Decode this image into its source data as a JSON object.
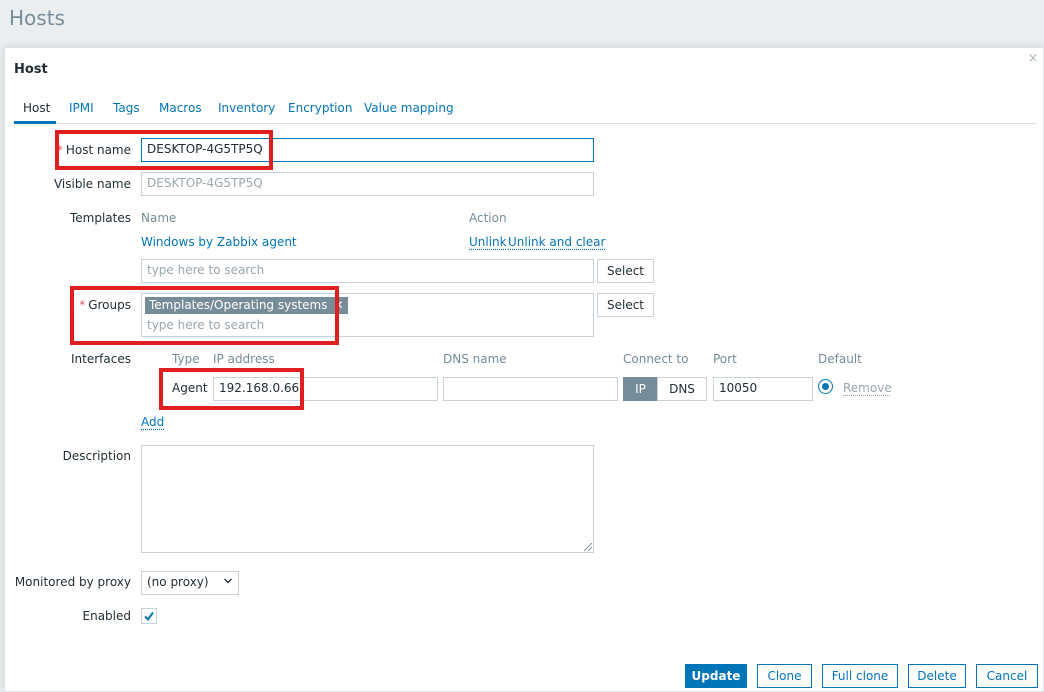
{
  "page": {
    "title": "Hosts"
  },
  "dialog": {
    "title": "Host",
    "close_glyph": "×"
  },
  "tabs": [
    {
      "label": "Host",
      "active": true
    },
    {
      "label": "IPMI"
    },
    {
      "label": "Tags"
    },
    {
      "label": "Macros"
    },
    {
      "label": "Inventory"
    },
    {
      "label": "Encryption"
    },
    {
      "label": "Value mapping"
    }
  ],
  "form": {
    "required_mark": "*",
    "host_name": {
      "label": "Host name",
      "value": "DESKTOP-4G5TP5Q"
    },
    "visible_name": {
      "label": "Visible name",
      "placeholder": "DESKTOP-4G5TP5Q"
    },
    "templates": {
      "label": "Templates",
      "col_name": "Name",
      "col_action": "Action",
      "rows": [
        {
          "name": "Windows by Zabbix agent",
          "unlink": "Unlink",
          "unlink_clear": "Unlink and clear"
        }
      ],
      "search_placeholder": "type here to search",
      "select_label": "Select"
    },
    "groups": {
      "label": "Groups",
      "chips": [
        "Templates/Operating systems"
      ],
      "search_placeholder": "type here to search",
      "select_label": "Select"
    },
    "interfaces": {
      "label": "Interfaces",
      "headers": {
        "type": "Type",
        "ip": "IP address",
        "dns": "DNS name",
        "connect": "Connect to",
        "port": "Port",
        "default": "Default"
      },
      "rows": [
        {
          "type": "Agent",
          "ip": "192.168.0.66",
          "dns": "",
          "connect_ip": "IP",
          "connect_dns": "DNS",
          "connect_selected": "IP",
          "port": "10050",
          "remove": "Remove"
        }
      ],
      "add_label": "Add"
    },
    "description": {
      "label": "Description",
      "value": ""
    },
    "proxy": {
      "label": "Monitored by proxy",
      "value": "(no proxy)"
    },
    "enabled": {
      "label": "Enabled",
      "checked": true
    }
  },
  "footer": {
    "update": "Update",
    "clone": "Clone",
    "full_clone": "Full clone",
    "delete": "Delete",
    "cancel": "Cancel"
  },
  "colors": {
    "accent": "#0275b8",
    "highlight_box": "#e02020",
    "required": "#e45959"
  }
}
